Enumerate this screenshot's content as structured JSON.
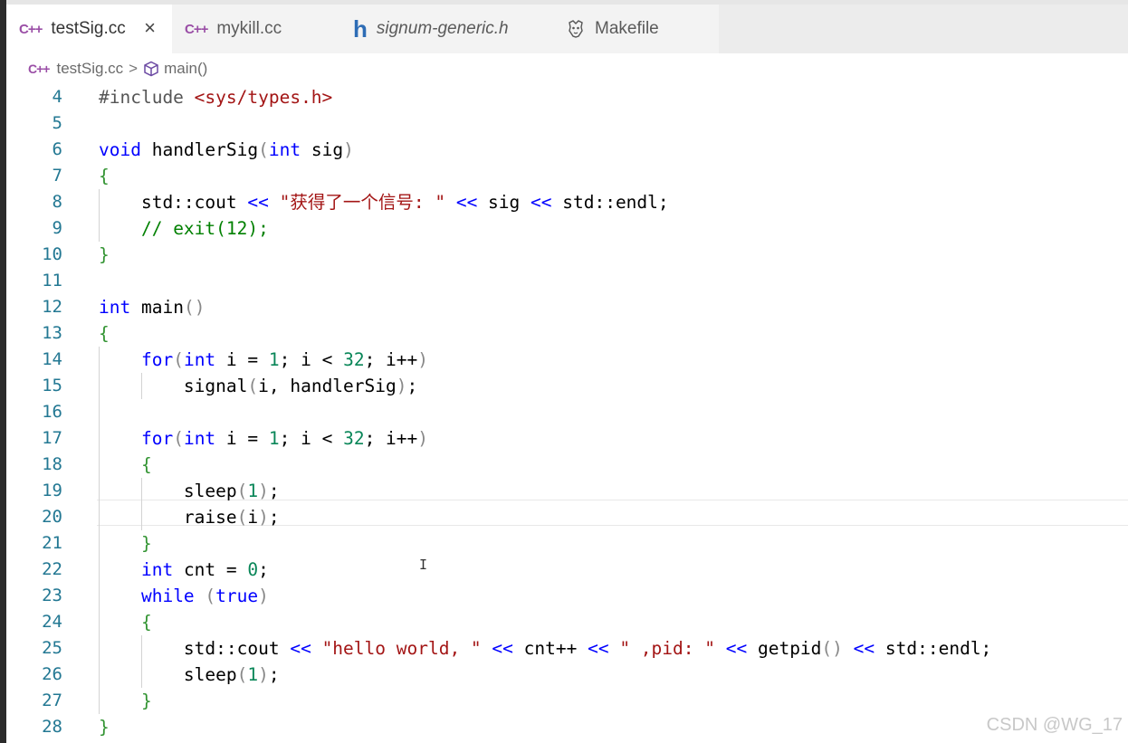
{
  "tabs": [
    {
      "icon": "C++",
      "label": "testSig.cc",
      "close": "×"
    },
    {
      "icon": "C++",
      "label": "mykill.cc"
    },
    {
      "icon": "h",
      "label": "signum-generic.h"
    },
    {
      "icon": "makefile-gnu",
      "label": "Makefile"
    }
  ],
  "breadcrumb": {
    "icon": "C++",
    "file": "testSig.cc",
    "sep": ">",
    "symbol": "main()"
  },
  "lines": [
    {
      "n": "4",
      "text": "#include <sys/types.h>"
    },
    {
      "n": "5",
      "text": ""
    },
    {
      "n": "6",
      "text": "void handlerSig(int sig)"
    },
    {
      "n": "7",
      "text": "{"
    },
    {
      "n": "8",
      "text": "    std::cout << \"获得了一个信号: \" << sig << std::endl;"
    },
    {
      "n": "9",
      "text": "    // exit(12);"
    },
    {
      "n": "10",
      "text": "}"
    },
    {
      "n": "11",
      "text": ""
    },
    {
      "n": "12",
      "text": "int main()"
    },
    {
      "n": "13",
      "text": "{"
    },
    {
      "n": "14",
      "text": "    for(int i = 1; i < 32; i++)"
    },
    {
      "n": "15",
      "text": "        signal(i, handlerSig);"
    },
    {
      "n": "16",
      "text": ""
    },
    {
      "n": "17",
      "text": "    for(int i = 1; i < 32; i++)"
    },
    {
      "n": "18",
      "text": "    {"
    },
    {
      "n": "19",
      "text": "        sleep(1);"
    },
    {
      "n": "20",
      "text": "        raise(i);"
    },
    {
      "n": "21",
      "text": "    }"
    },
    {
      "n": "22",
      "text": "    int cnt = 0;"
    },
    {
      "n": "23",
      "text": "    while (true)"
    },
    {
      "n": "24",
      "text": "    {"
    },
    {
      "n": "25",
      "text": "        std::cout << \"hello world, \" << cnt++ << \" ,pid: \" << getpid() << std::endl;"
    },
    {
      "n": "26",
      "text": "        sleep(1);"
    },
    {
      "n": "27",
      "text": "    }"
    },
    {
      "n": "28",
      "text": "}"
    }
  ],
  "cursor": "I",
  "watermark": "CSDN @WG_17",
  "colors": {
    "keyword": "#0000ff",
    "string": "#a31515",
    "comment": "#008000",
    "number": "#098658",
    "line_number": "#237893",
    "cpp_icon": "#9a4ea6",
    "h_icon": "#2d6cb5"
  }
}
